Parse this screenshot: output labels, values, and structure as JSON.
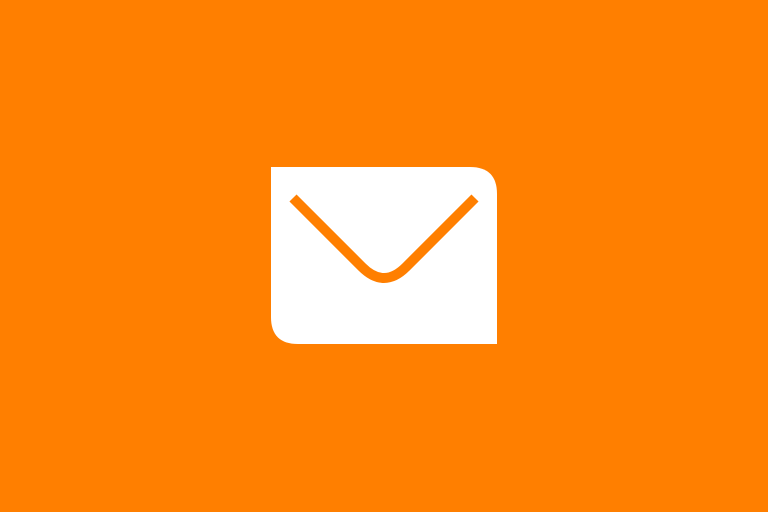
{
  "screen": {
    "background_color": "#ff7f00",
    "icon": {
      "name": "mail-envelope-icon",
      "body_color": "#ffffff",
      "flap_color": "#ff7f00"
    }
  }
}
